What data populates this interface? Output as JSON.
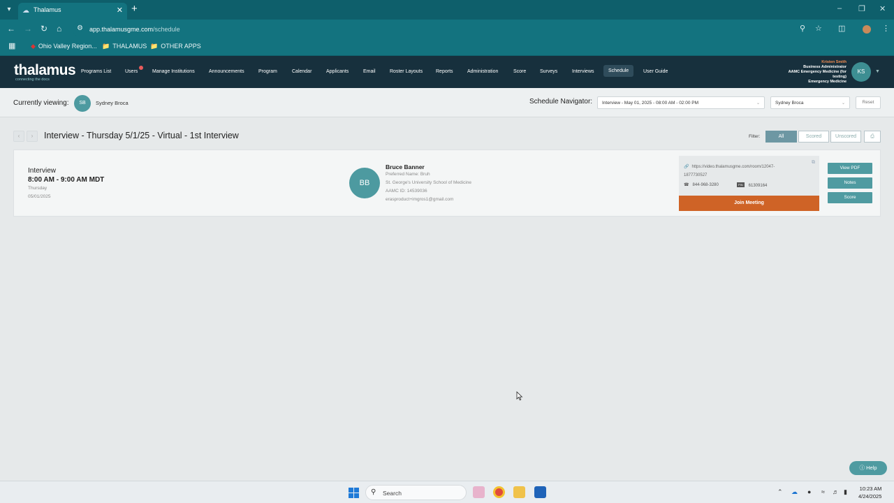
{
  "browser": {
    "tab_title": "Thalamus",
    "url_host": "app.thalamusgme.com",
    "url_path": "/schedule",
    "bookmarks": [
      "Ohio Valley Region...",
      "THALAMUS",
      "OTHER APPS"
    ]
  },
  "header": {
    "logo": "thalamus",
    "logo_tagline": "connecting the docs",
    "nav": [
      "Programs List",
      "Users",
      "Manage Institutions",
      "Announcements",
      "Program",
      "Calendar",
      "Applicants",
      "Email",
      "Roster Layouts",
      "Reports",
      "Administration",
      "Score",
      "Surveys",
      "Interviews",
      "Schedule",
      "User Guide"
    ],
    "active_nav": "Schedule",
    "user": {
      "name": "Kristen Smith",
      "role": "Business Administrator",
      "org1": "AAMC Emergency Medicine (for",
      "org2": "testing)",
      "dept": "Emergency Medicine",
      "initials": "KS"
    }
  },
  "viewing": {
    "label": "Currently viewing:",
    "initials": "SB",
    "name": "Sydney Broca",
    "navigator_label": "Schedule Navigator:",
    "navigator_value": "Interview - May 01, 2025 - 08:00 AM - 02:00 PM",
    "person_value": "Sydney Broca",
    "reset_label": "Reset"
  },
  "interview": {
    "title": "Interview - Thursday 5/1/25 - Virtual - 1st Interview",
    "filter_label": "Filter:",
    "filters": [
      "All",
      "Scored",
      "Unscored"
    ],
    "active_filter": "All"
  },
  "card": {
    "type": "Interview",
    "time": "8:00 AM - 9:00 AM MDT",
    "day": "Thursday",
    "date": "05/01/2025",
    "applicant_initials": "BB",
    "applicant_name": "Bruce Banner",
    "preferred_name": "Preferred Name: Bruh",
    "school": "St. George's University School of Medicine",
    "aamc_id": "AAMC ID: 14539036",
    "email": "erasproduct+imgros1@gmail.com",
    "meeting_link_1": "https://video.thalamusgme.com/room/12047-",
    "meeting_link_2": "1877730527",
    "phone": "844-968-3280",
    "pin_badge": "PIN",
    "pin": "61309164",
    "join_label": "Join Meeting",
    "actions": [
      "View PDF",
      "Notes",
      "Score"
    ]
  },
  "help_label": "Help",
  "taskbar": {
    "search_placeholder": "Search",
    "time": "10:23 AM",
    "date": "4/24/2025"
  },
  "colors": {
    "header_bg": "#17303d",
    "teal_button": "#4f9ba1",
    "join_orange": "#cf6326",
    "browser_teal": "#13737f"
  }
}
